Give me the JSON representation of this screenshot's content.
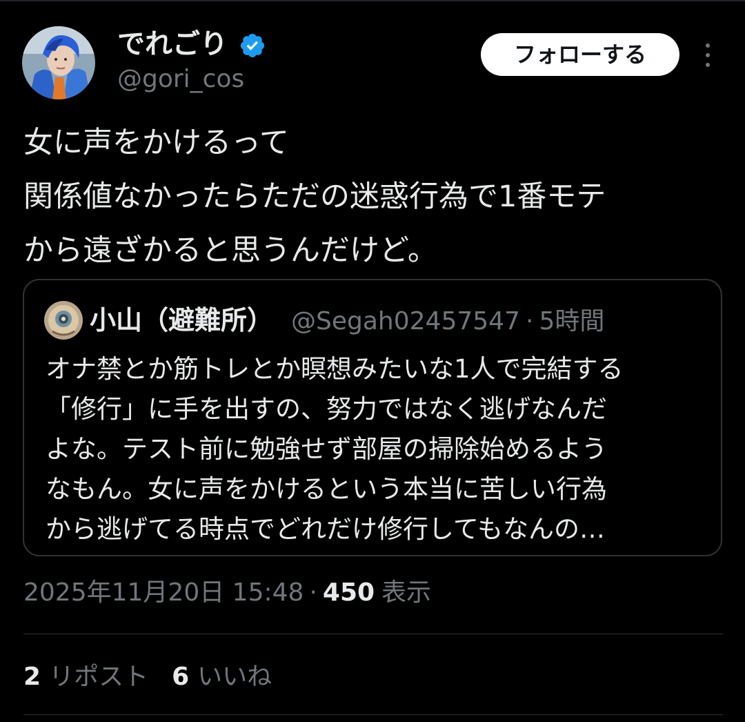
{
  "colors": {
    "background": "#000000",
    "text_primary": "#e7e9ea",
    "text_secondary": "#71767b",
    "border": "#2f3336",
    "verified_badge": "#1d9bf0",
    "follow_button_bg": "#ffffff"
  },
  "author": {
    "name": "でれごり",
    "handle": "@gori_cos",
    "verified_icon": "verified-badge-icon",
    "avatar_icon": "user-avatar"
  },
  "actions": {
    "follow_label": "フォローする",
    "more_icon": "more-vertical-icon"
  },
  "tweet": {
    "lines": [
      "女に声をかけるって",
      "関係値なかったらただの迷惑行為で1番モテ",
      "から遠ざかると思うんだけど。"
    ]
  },
  "quote": {
    "name": "小山（避難所）",
    "handle": "@Segah02457547",
    "separator": "·",
    "time": "5時間",
    "avatar_icon": "quote-user-avatar",
    "lines": [
      "オナ禁とか筋トレとか瞑想みたいな1人で完結する",
      "「修行」に手を出すの、努力ではなく逃げなんだ",
      "よな。テスト前に勉強せず部屋の掃除始めるよう",
      "なもん。女に声をかけるという本当に苦しい行為",
      "から逃げてる時点でどれだけ修行してもなんの…"
    ]
  },
  "meta": {
    "timestamp": "2025年11月20日 15:48",
    "separator": "·",
    "views": "450",
    "views_label": "表示"
  },
  "stats": {
    "reposts_count": "2",
    "reposts_label": "リポスト",
    "likes_count": "6",
    "likes_label": "いいね"
  }
}
